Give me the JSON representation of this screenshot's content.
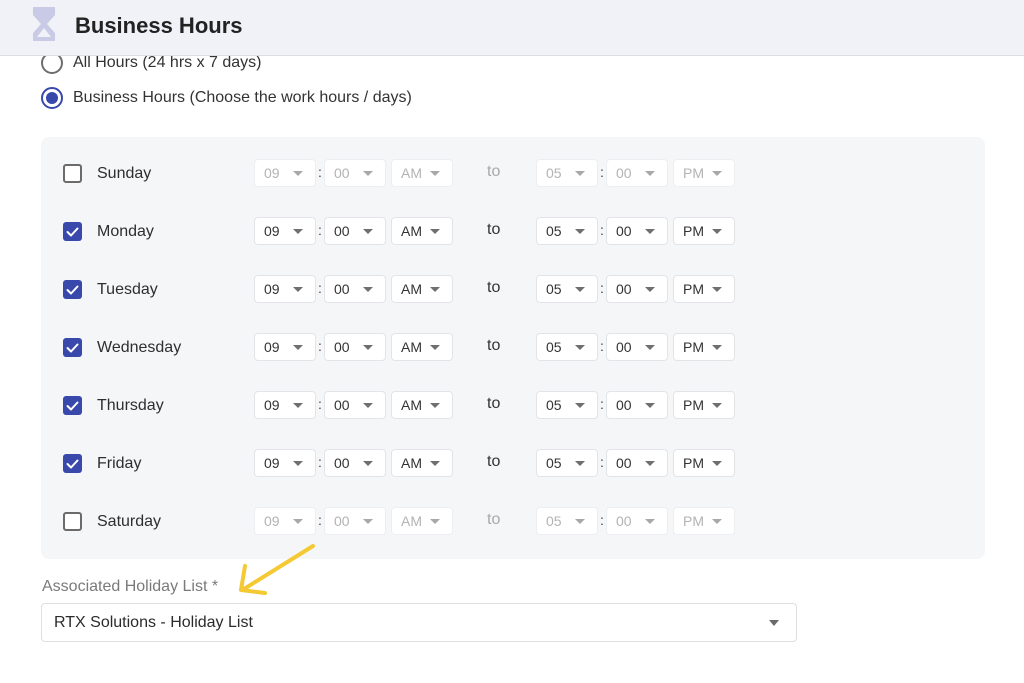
{
  "header": {
    "title": "Business Hours",
    "icon": "hourglass-icon"
  },
  "hours_mode": {
    "options": [
      {
        "label": "All Hours (24 hrs x 7 days)",
        "selected": false
      },
      {
        "label": "Business Hours (Choose the work hours / days)",
        "selected": true
      }
    ]
  },
  "schedule": {
    "separator": ":",
    "to_label": "to",
    "days": [
      {
        "name": "Sunday",
        "enabled": false,
        "start": {
          "hour": "09",
          "minute": "00",
          "ampm": "AM"
        },
        "end": {
          "hour": "05",
          "minute": "00",
          "ampm": "PM"
        }
      },
      {
        "name": "Monday",
        "enabled": true,
        "start": {
          "hour": "09",
          "minute": "00",
          "ampm": "AM"
        },
        "end": {
          "hour": "05",
          "minute": "00",
          "ampm": "PM"
        }
      },
      {
        "name": "Tuesday",
        "enabled": true,
        "start": {
          "hour": "09",
          "minute": "00",
          "ampm": "AM"
        },
        "end": {
          "hour": "05",
          "minute": "00",
          "ampm": "PM"
        }
      },
      {
        "name": "Wednesday",
        "enabled": true,
        "start": {
          "hour": "09",
          "minute": "00",
          "ampm": "AM"
        },
        "end": {
          "hour": "05",
          "minute": "00",
          "ampm": "PM"
        }
      },
      {
        "name": "Thursday",
        "enabled": true,
        "start": {
          "hour": "09",
          "minute": "00",
          "ampm": "AM"
        },
        "end": {
          "hour": "05",
          "minute": "00",
          "ampm": "PM"
        }
      },
      {
        "name": "Friday",
        "enabled": true,
        "start": {
          "hour": "09",
          "minute": "00",
          "ampm": "AM"
        },
        "end": {
          "hour": "05",
          "minute": "00",
          "ampm": "PM"
        }
      },
      {
        "name": "Saturday",
        "enabled": false,
        "start": {
          "hour": "09",
          "minute": "00",
          "ampm": "AM"
        },
        "end": {
          "hour": "05",
          "minute": "00",
          "ampm": "PM"
        }
      }
    ]
  },
  "holiday": {
    "label": "Associated Holiday List *",
    "value": "RTX Solutions - Holiday List"
  },
  "annotation": {
    "type": "arrow",
    "color": "#f5c934",
    "points_to": "Associated Holiday List"
  },
  "colors": {
    "accent": "#3949ab",
    "header_bg": "#f1f2f7",
    "panel_bg": "#f5f6f8"
  }
}
